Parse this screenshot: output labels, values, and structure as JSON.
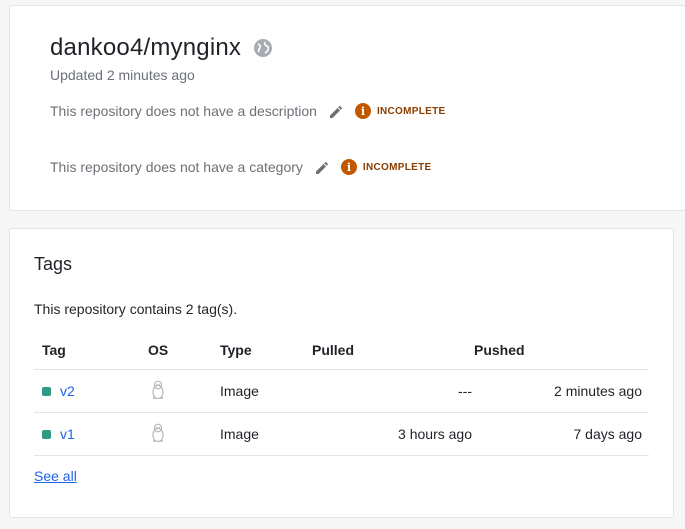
{
  "repository": {
    "name": "dankoo4/mynginx",
    "updated": "Updated 2 minutes ago",
    "description_text": "This repository does not have a description",
    "category_text": "This repository does not have a category",
    "incomplete_label": "INCOMPLETE",
    "visibility_icon": "globe-icon"
  },
  "tags": {
    "heading": "Tags",
    "summary": "This repository contains 2 tag(s).",
    "columns": {
      "tag": "Tag",
      "os": "OS",
      "type": "Type",
      "pulled": "Pulled",
      "pushed": "Pushed"
    },
    "rows": [
      {
        "tag": "v2",
        "os_icon": "linux-tux-icon",
        "type": "Image",
        "pulled": "---",
        "pushed": "2 minutes ago"
      },
      {
        "tag": "v1",
        "os_icon": "linux-tux-icon",
        "type": "Image",
        "pulled": "3 hours ago",
        "pushed": "7 days ago"
      }
    ],
    "see_all": "See all"
  },
  "colors": {
    "link": "#1d63ed",
    "incomplete": "#c25700",
    "tag_dot": "#2e9a86"
  }
}
